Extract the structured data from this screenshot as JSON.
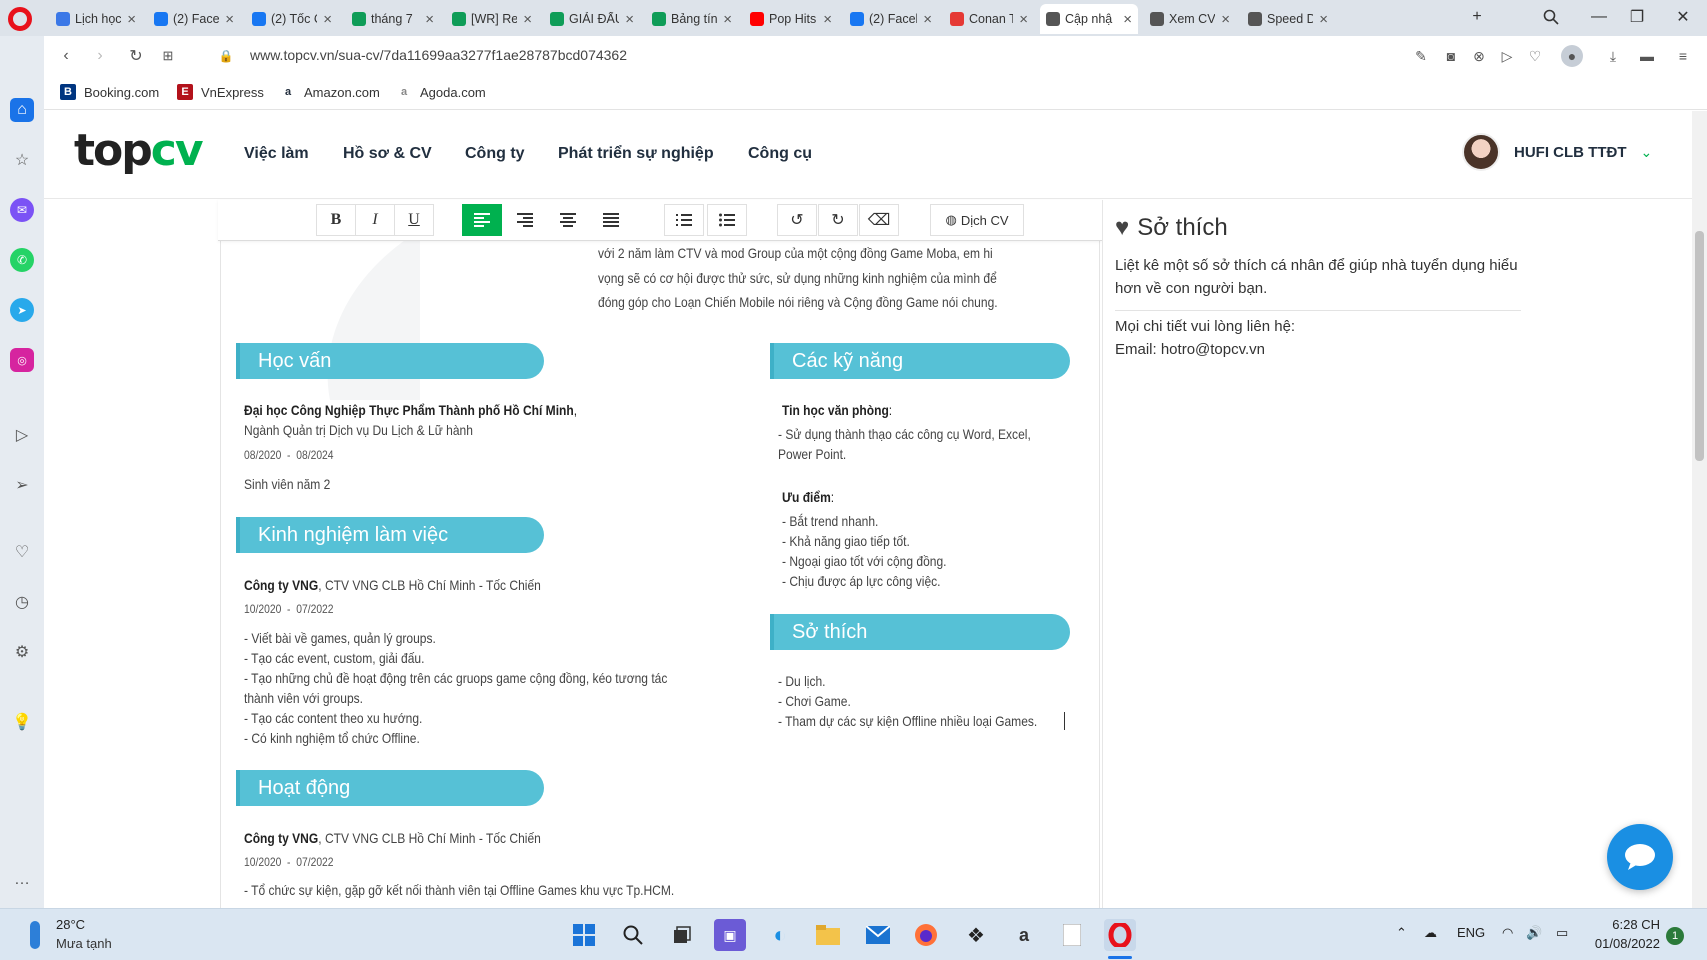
{
  "browser": {
    "tabs": [
      {
        "title": "Lịch học",
        "icon": "globe-icon",
        "color": "#3b78e7"
      },
      {
        "title": "(2) Faceb",
        "icon": "facebook-icon",
        "color": "#1877f2"
      },
      {
        "title": "(2) Tốc C",
        "icon": "facebook-icon",
        "color": "#1877f2"
      },
      {
        "title": "tháng 7",
        "icon": "sheets-icon",
        "color": "#0f9d58"
      },
      {
        "title": "[WR] Re",
        "icon": "sheets-icon",
        "color": "#0f9d58"
      },
      {
        "title": "GIẢI ĐẤU",
        "icon": "sheets-icon",
        "color": "#0f9d58"
      },
      {
        "title": "Bảng tín",
        "icon": "sheets-icon",
        "color": "#0f9d58"
      },
      {
        "title": "Pop Hits",
        "icon": "youtube-icon",
        "color": "#ff0000"
      },
      {
        "title": "(2) Faceb",
        "icon": "facebook-icon",
        "color": "#1877f2"
      },
      {
        "title": "Conan T",
        "icon": "video-icon",
        "color": "#e53935"
      },
      {
        "title": "Cập nhậ",
        "icon": "globe-icon",
        "color": "#555555",
        "active": true
      },
      {
        "title": "Xem CV",
        "icon": "globe-icon",
        "color": "#555555"
      },
      {
        "title": "Speed D",
        "icon": "grid-icon",
        "color": "#555555"
      }
    ],
    "url": "www.topcv.vn/sua-cv/7da11699aa3277f1ae28787bcd074362",
    "bookmarks": [
      {
        "label": "Booking.com",
        "badge": "B",
        "color": "#003580"
      },
      {
        "label": "VnExpress",
        "badge": "E",
        "color": "#b3121b"
      },
      {
        "label": "Amazon.com",
        "badge": "a",
        "color": "#232f3e"
      },
      {
        "label": "Agoda.com",
        "badge": "a",
        "color": "#888888"
      }
    ]
  },
  "site": {
    "logo_top": "top",
    "logo_cv": "cv",
    "menu": [
      "Việc làm",
      "Hồ sơ & CV",
      "Công ty",
      "Phát triển sự nghiệp",
      "Công cụ"
    ],
    "user_name": "HUFI CLB TTĐT",
    "accent_color": "#00b14f"
  },
  "toolbar": {
    "bold": "B",
    "italic": "I",
    "underline": "U",
    "translate": "Dịch CV"
  },
  "cv": {
    "objective_lines": [
      "với 2 năm làm CTV và mod Group của một cộng đồng Game Moba, em hi",
      "vọng sẽ có cơ hội được thử sức, sử dụng những kinh nghiệm của mình để",
      "đóng góp cho Loạn Chiến Mobile nói riêng và Cộng đồng Game nói chung."
    ],
    "education": {
      "title": "Học vấn",
      "school": "Đại học Công Nghiệp Thực Phẩm Thành phố Hồ Chí Minh",
      "school_suffix": ",",
      "major": "Ngành Quản trị Dịch vụ Du Lịch & Lữ hành",
      "start": "08/2020",
      "end": "08/2024",
      "dash": "-",
      "note": "Sinh viên năm 2"
    },
    "experience": {
      "title": "Kinh nghiệm làm việc",
      "company": "Công ty VNG",
      "role": ", CTV VNG CLB Hồ Chí Minh - Tốc Chiến",
      "start": "10/2020",
      "end": "07/2022",
      "dash": "-",
      "items": [
        "- Viết bài về games, quản lý groups.",
        "- Tạo các event, custom, giải đấu.",
        "- Tạo những chủ đề hoạt động trên các gruops game cộng đồng, kéo tương tác",
        "thành viên với groups.",
        "- Tạo các content theo xu hướng.",
        "- Có kinh nghiệm tổ chức Offline."
      ]
    },
    "activities": {
      "title": "Hoạt động",
      "company": "Công ty VNG",
      "role": ", CTV VNG CLB Hồ Chí Minh - Tốc Chiến",
      "start": "10/2020",
      "end": "07/2022",
      "dash": "-",
      "items": [
        "- Tổ chức sự kiện, gặp gỡ kết nối thành viên tại Offline Games khu vực Tp.HCM."
      ]
    },
    "skills": {
      "title": "Các kỹ năng",
      "group1_title": "Tin học văn phòng",
      "group1_suffix": ":",
      "group1_lines": [
        "- Sử dụng thành thạo các công cụ Word, Excel,",
        "Power Point."
      ],
      "group2_title": "Ưu điểm",
      "group2_suffix": ":",
      "group2_lines": [
        "- Bắt trend nhanh.",
        "- Khả năng giao tiếp tốt.",
        "- Ngoại giao tốt với cộng đồng.",
        "- Chịu được áp lực công việc."
      ]
    },
    "hobbies": {
      "title": "Sở thích",
      "lines": [
        "- Du lịch.",
        "- Chơi Game.",
        "- Tham dự các sự kiện Offline nhiều loại Games."
      ]
    },
    "section_color": "#56c1d6"
  },
  "hint": {
    "title": "Sở thích",
    "description": "Liệt kê một số sở thích cá nhân để giúp nhà tuyển dụng hiểu hơn về con người bạn.",
    "contact_line1": "Mọi chi tiết vui lòng liên hệ:",
    "contact_line2": "Email: hotro@topcv.vn"
  },
  "taskbar": {
    "temperature": "28°C",
    "weather": "Mưa tạnh",
    "language": "ENG",
    "time": "6:28 CH",
    "date": "01/08/2022",
    "notifications": "1"
  }
}
